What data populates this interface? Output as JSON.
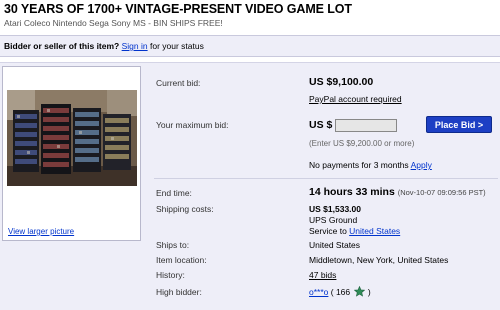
{
  "listing": {
    "title": "30 YEARS OF 1700+ VINTAGE-PRESENT VIDEO GAME LOT",
    "subtitle": "Atari Coleco Nintendo Sega Sony MS - BIN SHIPS FREE!"
  },
  "status": {
    "prompt": "Bidder or seller of this item?",
    "sign_in": "Sign in",
    "suffix": " for your status"
  },
  "image": {
    "view_larger": "View larger picture"
  },
  "bid": {
    "current_bid_label": "Current bid:",
    "current_bid_value": "US $9,100.00",
    "paypal_link": "PayPal account required",
    "max_bid_label": "Your maximum bid:",
    "currency_prefix": "US $",
    "max_bid_value": "",
    "place_bid_button": "Place Bid >",
    "min_bid_hint": "(Enter US $9,200.00 or more)",
    "payments_text": "No payments for 3 months ",
    "apply_link": "Apply"
  },
  "details": {
    "end_time_label": "End time:",
    "end_time_value": "14 hours 33 mins",
    "end_time_date": "(Nov-10-07 09:09:56 PST)",
    "shipping_label": "Shipping costs:",
    "shipping_cost": "US $1,533.00",
    "shipping_method": "UPS Ground",
    "service_to_prefix": "Service to ",
    "service_to_link": "United States",
    "ships_to_label": "Ships to:",
    "ships_to_value": "United States",
    "location_label": "Item location:",
    "location_value": "Middletown, New York, United States",
    "history_label": "History:",
    "history_link": "47 bids",
    "high_bidder_label": "High bidder:",
    "high_bidder_name": "o***o",
    "feedback_open": " ( 166 ",
    "feedback_close": " )",
    "feedback_star": "green-star-icon"
  },
  "colors": {
    "link": "#0033cc",
    "panel_bg": "#eeeef8",
    "place_bid": "#1d3fc4"
  }
}
